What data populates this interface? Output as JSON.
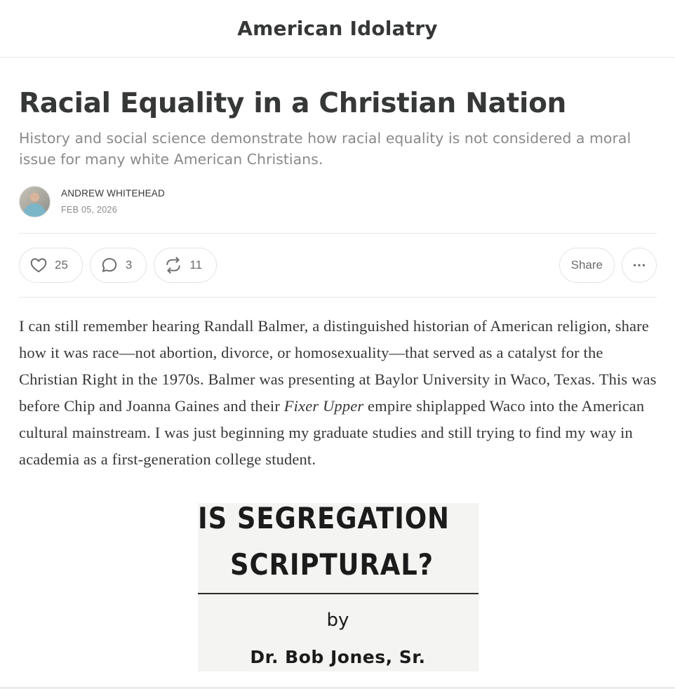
{
  "header": {
    "publication": "American Idolatry"
  },
  "post": {
    "title": "Racial Equality in a Christian Nation",
    "subtitle": "History and social science demonstrate how racial equality is not considered a moral issue for many white American Christians.",
    "author": "ANDREW WHITEHEAD",
    "date": "FEB 05, 2026"
  },
  "actions": {
    "likes": "25",
    "comments": "3",
    "restacks": "11",
    "share_label": "Share"
  },
  "icons": {
    "like": "heart-icon",
    "comment": "comment-bubble-icon",
    "restack": "restack-icon",
    "more": "more-dots-icon"
  },
  "body": {
    "p1_a": "I can still remember hearing Randall Balmer, a distinguished historian of American religion, share how it was race—not abortion, divorce, or homosexuality—that served as a catalyst for the Christian Right in the 1970s. Balmer was presenting at Baylor University in Waco, Texas. This was before Chip and Joanna Gaines and their ",
    "p1_em": "Fixer Upper",
    "p1_b": " empire shiplapped Waco into the American cultural mainstream. I was just beginning my graduate studies and still trying to find my way in academia as a first-generation college student."
  },
  "figure": {
    "line1": "IS SEGREGATION",
    "line2": "SCRIPTURAL?",
    "by": "by",
    "author": "Dr. Bob Jones, Sr."
  }
}
